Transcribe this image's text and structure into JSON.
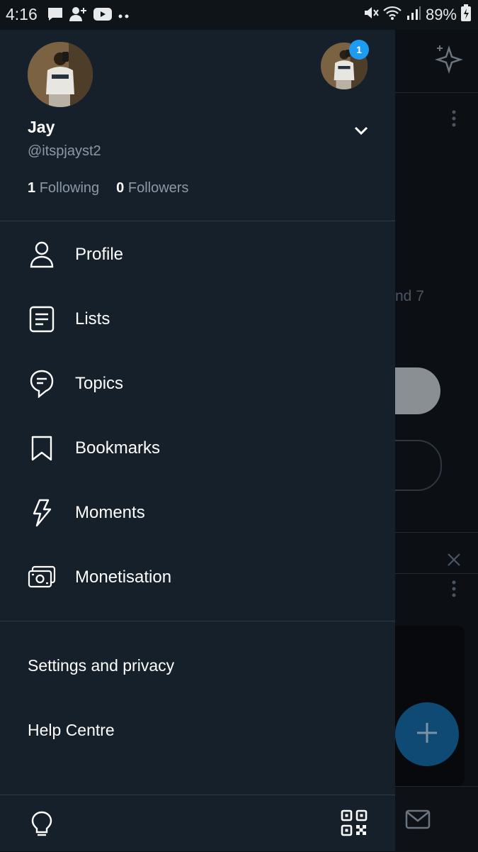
{
  "status_bar": {
    "time": "4:16",
    "battery": "89%",
    "left_icons": [
      "message-icon",
      "add-person-icon",
      "youtube-icon",
      "more-dots-icon"
    ],
    "right_icons": [
      "mute-icon",
      "wifi-icon",
      "signal-icon",
      "battery-charging-icon"
    ]
  },
  "profile": {
    "name": "Jay",
    "handle": "@itspjayst2",
    "following_count": "1",
    "following_label": "Following",
    "followers_count": "0",
    "followers_label": "Followers",
    "account_badge": "1"
  },
  "menu": [
    {
      "label": "Profile",
      "icon": "person-icon"
    },
    {
      "label": "Lists",
      "icon": "list-icon"
    },
    {
      "label": "Topics",
      "icon": "topic-icon"
    },
    {
      "label": "Bookmarks",
      "icon": "bookmark-icon"
    },
    {
      "label": "Moments",
      "icon": "lightning-icon"
    },
    {
      "label": "Monetisation",
      "icon": "money-icon"
    }
  ],
  "secondary": {
    "settings": "Settings and privacy",
    "help": "Help Centre"
  },
  "background": {
    "partial_text": "nd 7"
  },
  "colors": {
    "drawer_bg": "#16202b",
    "accent": "#1d9bf0",
    "secondary_text": "#8b98a5"
  }
}
